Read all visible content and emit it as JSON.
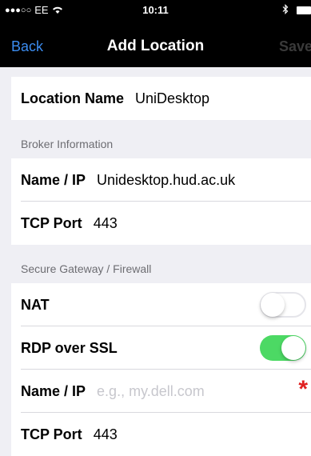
{
  "status_bar": {
    "signal_dots": "●●●○○",
    "carrier": "EE",
    "wifi_icon": "wifi-icon",
    "time": "10:11",
    "bluetooth_icon": "bluetooth-icon",
    "battery_icon": "battery-icon"
  },
  "nav": {
    "back": "Back",
    "title": "Add Location",
    "save": "Save"
  },
  "location": {
    "label": "Location Name",
    "value": "UniDesktop"
  },
  "broker": {
    "header": "Broker Information",
    "name_label": "Name / IP",
    "name_value": "Unidesktop.hud.ac.uk",
    "port_label": "TCP Port",
    "port_value": "443"
  },
  "gateway": {
    "header": "Secure Gateway / Firewall",
    "nat_label": "NAT",
    "nat_on": false,
    "rdp_label": "RDP over SSL",
    "rdp_on": true,
    "name_label": "Name / IP",
    "name_placeholder": "e.g., my.dell.com",
    "required_marker": "*",
    "port_label": "TCP Port",
    "port_value": "443"
  },
  "colors": {
    "accent": "#3b8cf0",
    "toggle_on": "#4cd964",
    "required": "#e02020"
  }
}
